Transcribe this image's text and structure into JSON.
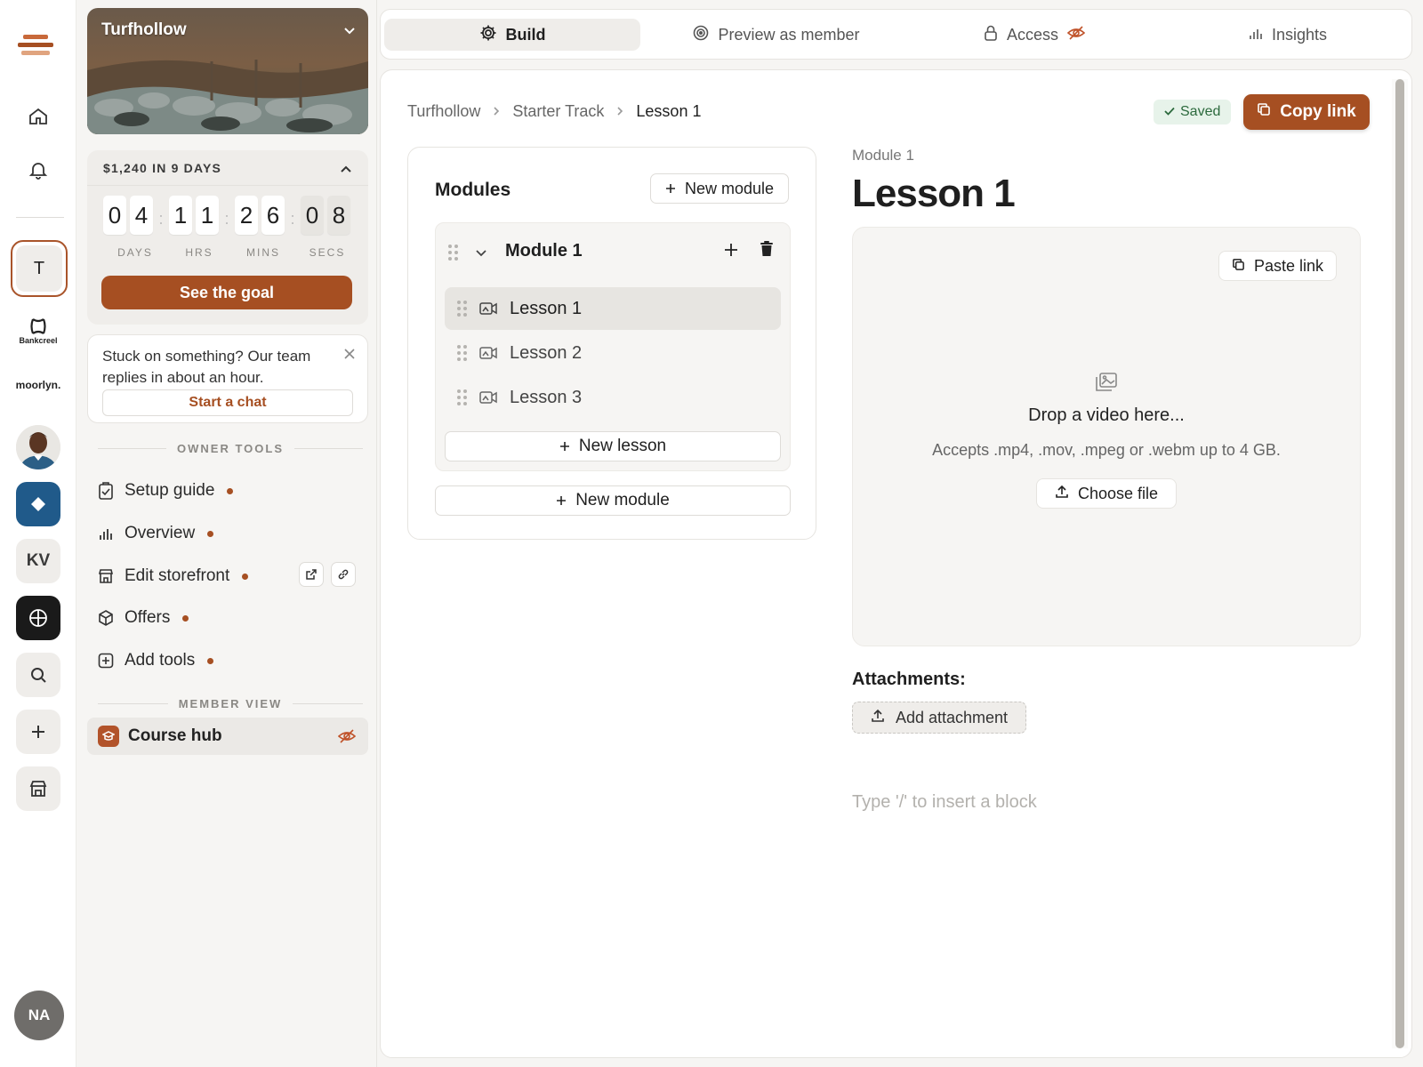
{
  "rail": {
    "brand_labels": [
      "Bankcreel",
      "moorlyn."
    ],
    "t_tile": "T",
    "kv_tile": "KV",
    "user_initials": "NA"
  },
  "sidebar": {
    "workspace_name": "Turfhollow",
    "goal": {
      "label": "$1,240 IN 9 DAYS",
      "digits": [
        "0",
        "4",
        "1",
        "1",
        "2",
        "6",
        "0",
        "8"
      ],
      "unit_labels": [
        "DAYS",
        "HRS",
        "MINS",
        "SECS"
      ],
      "button": "See the goal"
    },
    "help": {
      "message": "Stuck on something? Our team replies in about an hour.",
      "button": "Start a chat"
    },
    "owner_tools_label": "OWNER TOOLS",
    "owner_tools": [
      {
        "label": "Setup guide",
        "icon": "clipboard-check-icon"
      },
      {
        "label": "Overview",
        "icon": "bar-chart-icon"
      },
      {
        "label": "Edit storefront",
        "icon": "storefront-icon"
      },
      {
        "label": "Offers",
        "icon": "box-icon"
      },
      {
        "label": "Add tools",
        "icon": "plus-square-icon"
      }
    ],
    "member_view_label": "MEMBER VIEW",
    "member_item": "Course hub"
  },
  "tabs": [
    {
      "label": "Build",
      "icon": "gear-icon",
      "active": true
    },
    {
      "label": "Preview as member",
      "icon": "target-icon",
      "active": false
    },
    {
      "label": "Access",
      "icon": "lock-icon",
      "active": false
    },
    {
      "label": "Insights",
      "icon": "bar-chart-icon",
      "active": false
    }
  ],
  "breadcrumb": [
    "Turfhollow",
    "Starter Track",
    "Lesson 1"
  ],
  "status": {
    "saved": "Saved",
    "copy_link": "Copy link"
  },
  "modules": {
    "title": "Modules",
    "new_module": "New module",
    "module_name": "Module 1",
    "lessons": [
      "Lesson 1",
      "Lesson 2",
      "Lesson 3"
    ],
    "new_lesson": "New lesson",
    "new_module_bottom": "New module"
  },
  "editor": {
    "module_label": "Module 1",
    "lesson_title": "Lesson 1",
    "paste_link": "Paste link",
    "drop_title": "Drop a video here...",
    "drop_sub": "Accepts .mp4, .mov, .mpeg or .webm up to 4 GB.",
    "choose_file": "Choose file",
    "attachments_label": "Attachments:",
    "add_attachment": "Add attachment",
    "block_placeholder": "Type '/' to insert a block"
  },
  "colors": {
    "accent": "#a64f22",
    "saved_bg": "#e7f3ea"
  }
}
